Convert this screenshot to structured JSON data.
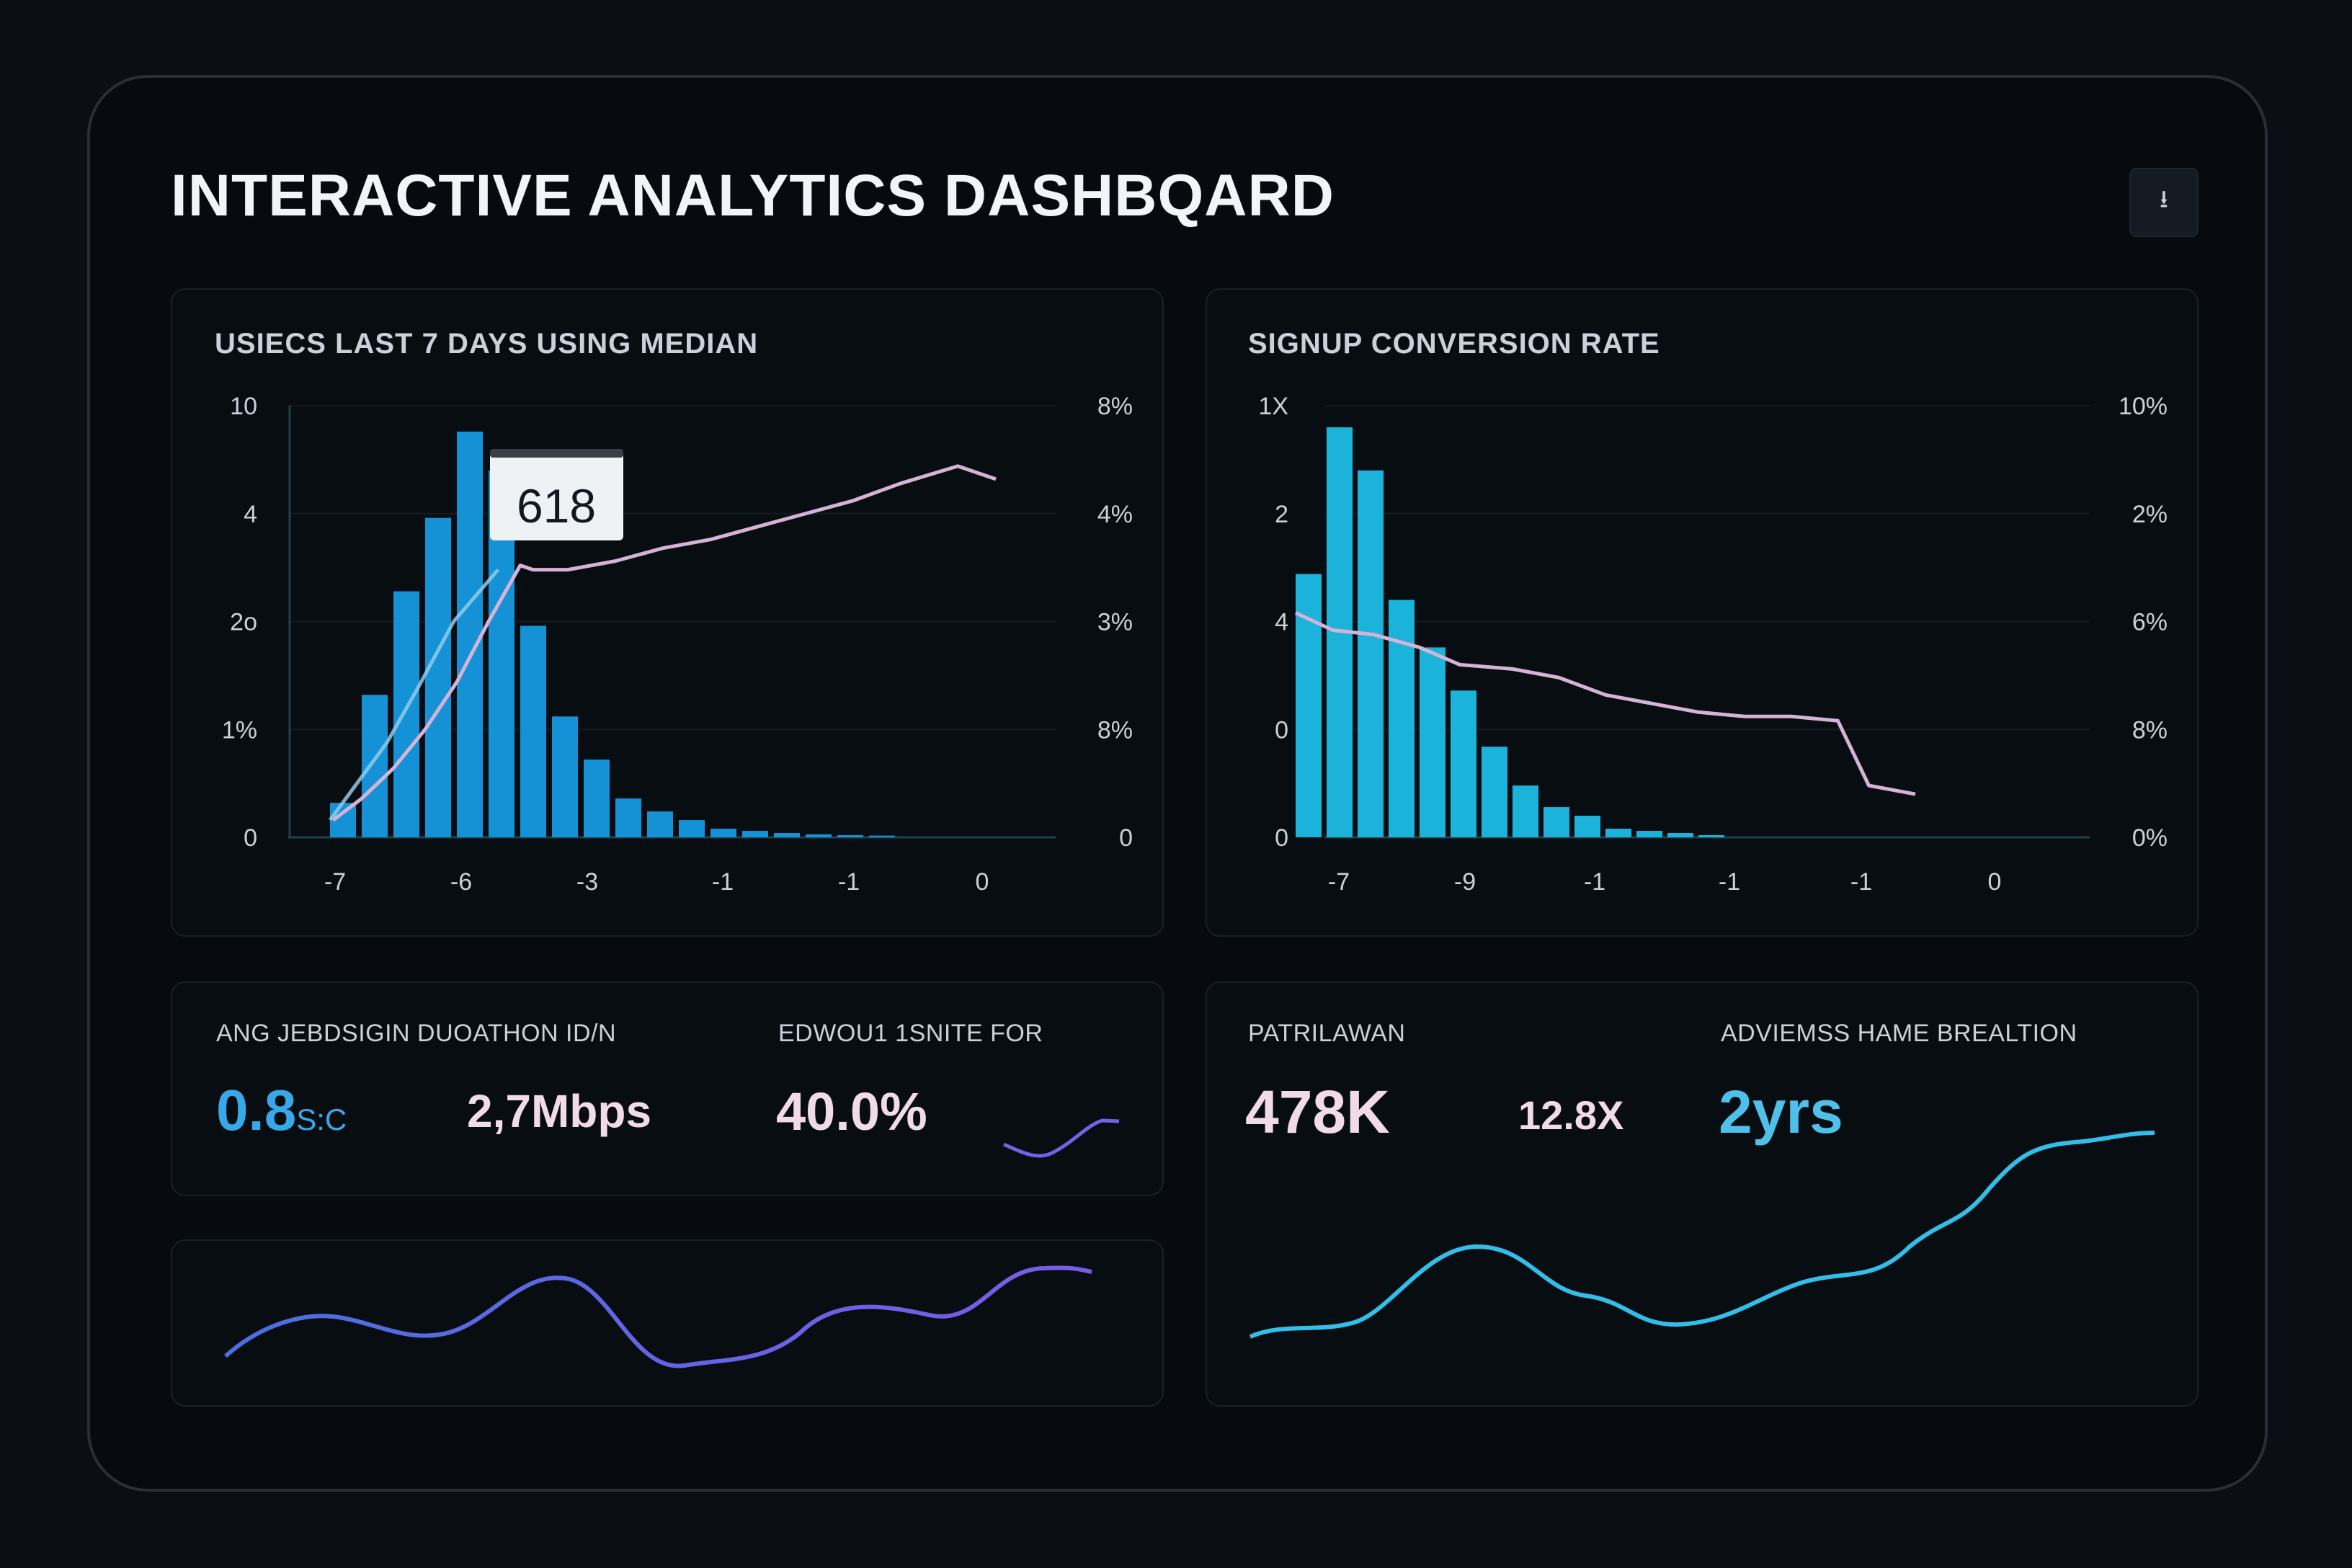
{
  "header": {
    "title": "INTERACTIVE ANALYTICS DASHBQARD",
    "download_icon": "download-icon",
    "download_glyph": "⭳"
  },
  "colors": {
    "bar_left": "#1591d6",
    "bar_right": "#1bb3da",
    "line_pink": "#d6b3d6",
    "line_light": "#8fcbe8",
    "accent_blue": "#38a8e8",
    "accent_purple": "#6f63e6",
    "spark_cyan": "#33bde8",
    "text_pink": "#f1dbe8"
  },
  "chart_data": [
    {
      "type": "bar",
      "title": "USIECS LAST  7 DAYS USING MEDIAN",
      "y_ticks_left": [
        "10",
        "4",
        "2o",
        "1%",
        "0"
      ],
      "y_ticks_right": [
        "8%",
        "4%",
        "3%",
        "8%",
        "0"
      ],
      "x_ticks": [
        "-7",
        "-6",
        "-3",
        "-1",
        "-1",
        "0"
      ],
      "bar_values": [
        0.8,
        3.3,
        5.7,
        7.4,
        9.4,
        8.5,
        4.9,
        2.8,
        1.8,
        0.9,
        0.6,
        0.4,
        0.2,
        0.15,
        0.1,
        0.07,
        0.05,
        0.04
      ],
      "ylim": [
        0,
        10
      ],
      "callout": "618",
      "series": [
        {
          "values": [
            0.4,
            0.9,
            1.6,
            2.5,
            3.6,
            5.0,
            6.3,
            6.2,
            6.2,
            6.4,
            6.7,
            6.9,
            7.2,
            7.5,
            7.8,
            8.2,
            8.6,
            8.3
          ],
          "x": [
            0.1,
            1.0,
            2.0,
            3.0,
            4.0,
            5.0,
            6.0,
            6.4,
            7.5,
            9.0,
            10.5,
            12.0,
            13.5,
            15.0,
            16.5,
            18.0,
            19.8,
            21.0
          ]
        },
        {
          "values": [
            0.4,
            1.2,
            2.2,
            3.5,
            5.0,
            6.2
          ],
          "x": [
            0.0,
            0.8,
            1.8,
            2.8,
            3.9,
            5.3
          ]
        }
      ]
    },
    {
      "type": "bar",
      "title": "SIGNUP CONVERSION RATE",
      "y_ticks_left": [
        "1X",
        "2",
        "4",
        "0",
        "0"
      ],
      "y_ticks_right": [
        "10%",
        "2%",
        "6%",
        "8%",
        "0%"
      ],
      "x_ticks": [
        "-7",
        "-9",
        "-1",
        "-1",
        "-1",
        "0"
      ],
      "bar_values": [
        6.1,
        9.5,
        8.5,
        5.5,
        4.4,
        3.4,
        2.1,
        1.2,
        0.7,
        0.5,
        0.2,
        0.15,
        0.1,
        0.05
      ],
      "ylim": [
        0,
        10
      ],
      "series": [
        {
          "values": [
            5.2,
            4.8,
            4.7,
            4.4,
            4.0,
            3.9,
            3.7,
            3.3,
            3.1,
            2.9,
            2.8,
            2.8,
            2.7,
            1.2,
            1.0
          ],
          "x": [
            0.0,
            1.2,
            2.5,
            4.0,
            5.3,
            7.0,
            8.5,
            10.0,
            11.5,
            13.0,
            14.5,
            16.0,
            17.5,
            18.5,
            20.0
          ]
        }
      ]
    }
  ],
  "stats_left": {
    "label_1": "ANG  JEBDSIGIN DUOATHON ID/N",
    "label_2": "EDWOU1 1SNITE FOR",
    "value_1": "0.8",
    "value_1_unit": "S:C",
    "value_2": "2,7Mbps",
    "value_3": "40.0%"
  },
  "stats_right": {
    "label_1": "PATRILAWAN",
    "label_2": "ADVIEMSS HAME BREALTION",
    "value_1": "478K",
    "value_2": "12.8X",
    "value_3": "2yrs"
  }
}
